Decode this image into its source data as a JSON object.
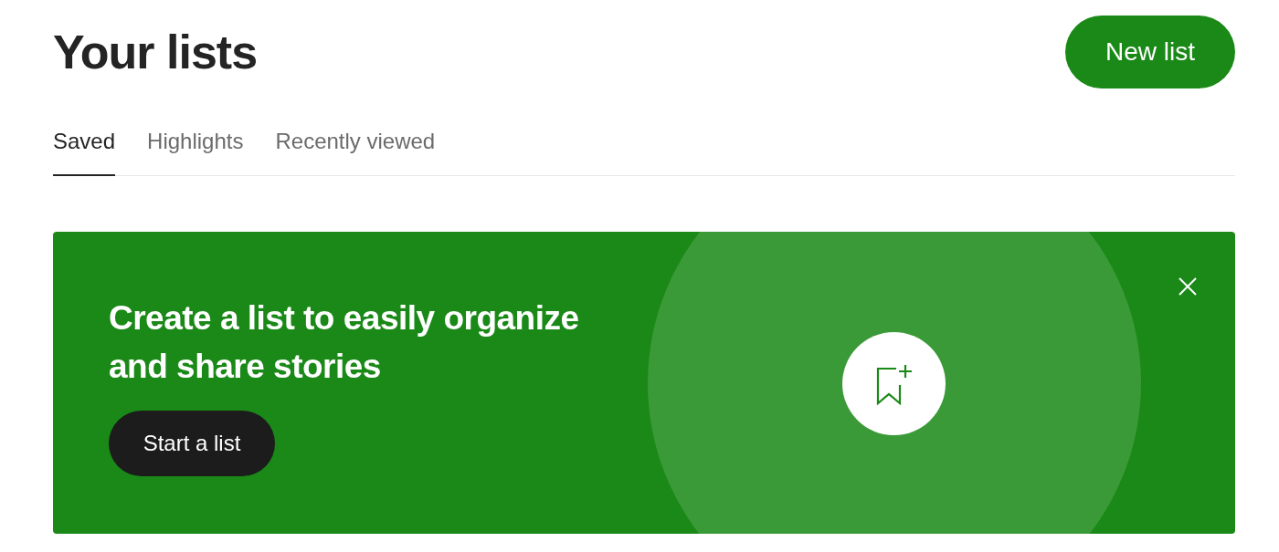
{
  "title": "Your lists",
  "new_list_button": "New list",
  "tabs": [
    {
      "label": "Saved",
      "selected": true
    },
    {
      "label": "Highlights",
      "selected": false
    },
    {
      "label": "Recently viewed",
      "selected": false
    }
  ],
  "banner": {
    "heading": "Create a list to easily organize and share stories",
    "button": "Start a list"
  }
}
